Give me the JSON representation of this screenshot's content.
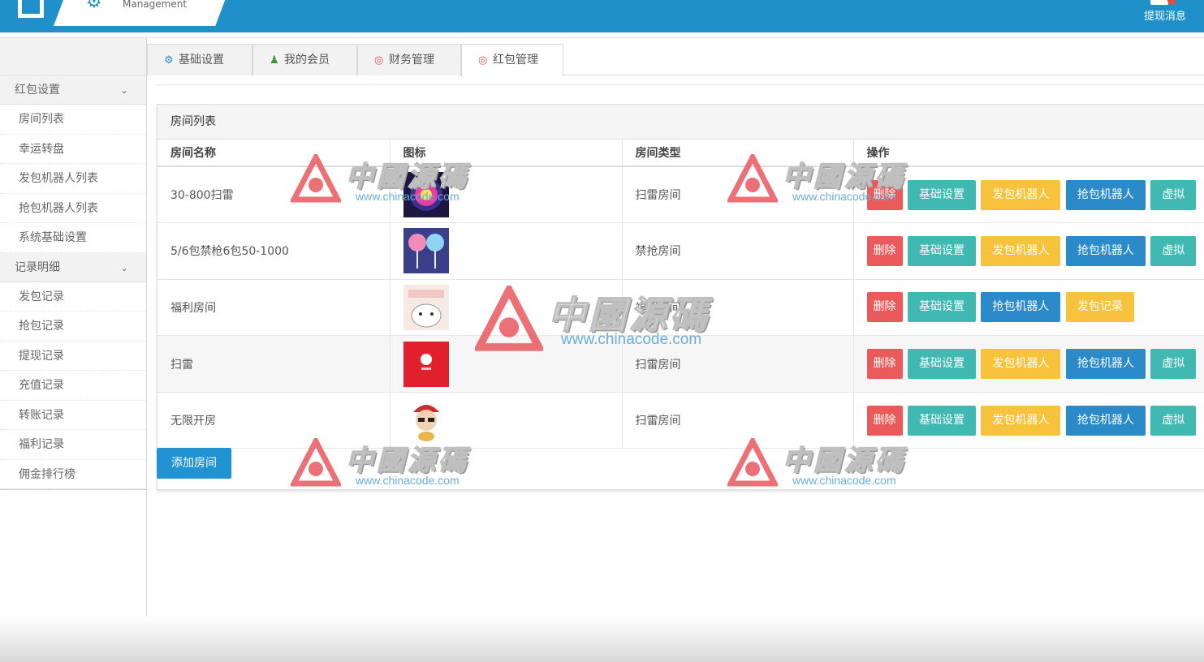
{
  "header": {
    "brand_text": "Management",
    "notif_badge": "",
    "notif_label": "提现消息"
  },
  "sidebar": {
    "sections": [
      {
        "title": "红包设置",
        "items": [
          "房间列表",
          "幸运转盘",
          "发包机器人列表",
          "抢包机器人列表",
          "系统基础设置"
        ]
      },
      {
        "title": "记录明细",
        "items": [
          "发包记录",
          "抢包记录",
          "提现记录",
          "充值记录",
          "转账记录",
          "福利记录",
          "佣金排行榜"
        ]
      }
    ]
  },
  "tabs": [
    {
      "label": "基础设置",
      "icon": "gear-icon"
    },
    {
      "label": "我的会员",
      "icon": "user-icon"
    },
    {
      "label": "财务管理",
      "icon": "finance-icon"
    },
    {
      "label": "红包管理",
      "icon": "redpacket-icon"
    }
  ],
  "panel": {
    "title": "房间列表",
    "columns": [
      "房间名称",
      "图标",
      "房间类型",
      "操作"
    ],
    "rows": [
      {
        "name": "30-800扫雷",
        "type": "扫雷房间",
        "icon": "lucky-icon",
        "actions": [
          "删除",
          "基础设置",
          "发包机器人",
          "抢包机器人",
          "虚拟"
        ]
      },
      {
        "name": "5/6包禁枪6包50-1000",
        "type": "禁抢房间",
        "icon": "lollipop-icon",
        "actions": [
          "删除",
          "基础设置",
          "发包机器人",
          "抢包机器人",
          "虚拟"
        ]
      },
      {
        "name": "福利房间",
        "type": "福利房间",
        "icon": "cat-icon",
        "actions": [
          "删除",
          "基础设置",
          "抢包机器人",
          "发包记录"
        ]
      },
      {
        "name": "扫雷",
        "type": "扫雷房间",
        "icon": "redbag-icon",
        "actions": [
          "删除",
          "基础设置",
          "发包机器人",
          "抢包机器人",
          "虚拟"
        ]
      },
      {
        "name": "无限开房",
        "type": "扫雷房间",
        "icon": "cartoon-icon",
        "actions": [
          "删除",
          "基础设置",
          "发包机器人",
          "抢包机器人",
          "虚拟"
        ]
      }
    ],
    "add_button": "添加房间"
  },
  "watermark": {
    "title": "中國源碼",
    "url": "www.chinacode.com"
  }
}
